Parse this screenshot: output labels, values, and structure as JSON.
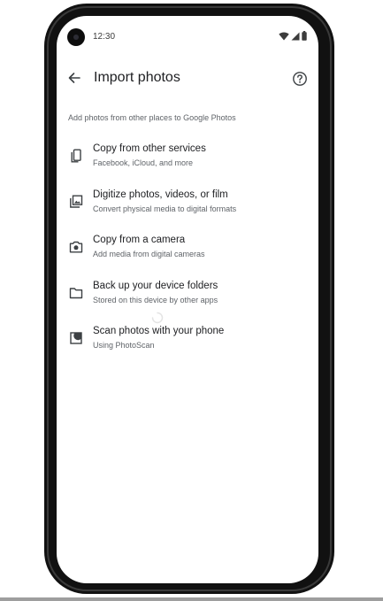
{
  "status_bar": {
    "time": "12:30",
    "icons": [
      "wifi-icon",
      "signal-icon",
      "battery-icon"
    ]
  },
  "app_bar": {
    "back_icon": "arrow-back-icon",
    "title": "Import photos",
    "help_icon": "help-circle-icon"
  },
  "subtitle": "Add photos from other places to Google Photos",
  "options": [
    {
      "icon": "phone-copy-icon",
      "title": "Copy from other services",
      "subtitle": "Facebook, iCloud, and more"
    },
    {
      "icon": "photo-library-icon",
      "title": "Digitize photos, videos, or film",
      "subtitle": "Convert physical media to digital formats"
    },
    {
      "icon": "camera-icon",
      "title": "Copy from a camera",
      "subtitle": "Add media from digital cameras"
    },
    {
      "icon": "folder-icon",
      "title": "Back up your device folders",
      "subtitle": "Stored on this device by other apps"
    },
    {
      "icon": "photoscan-icon",
      "title": "Scan photos with your phone",
      "subtitle": "Using PhotoScan"
    }
  ],
  "colors": {
    "text_primary": "#202124",
    "text_secondary": "#5f6368",
    "icon": "#3c4043",
    "phone_frame": "#111111"
  }
}
